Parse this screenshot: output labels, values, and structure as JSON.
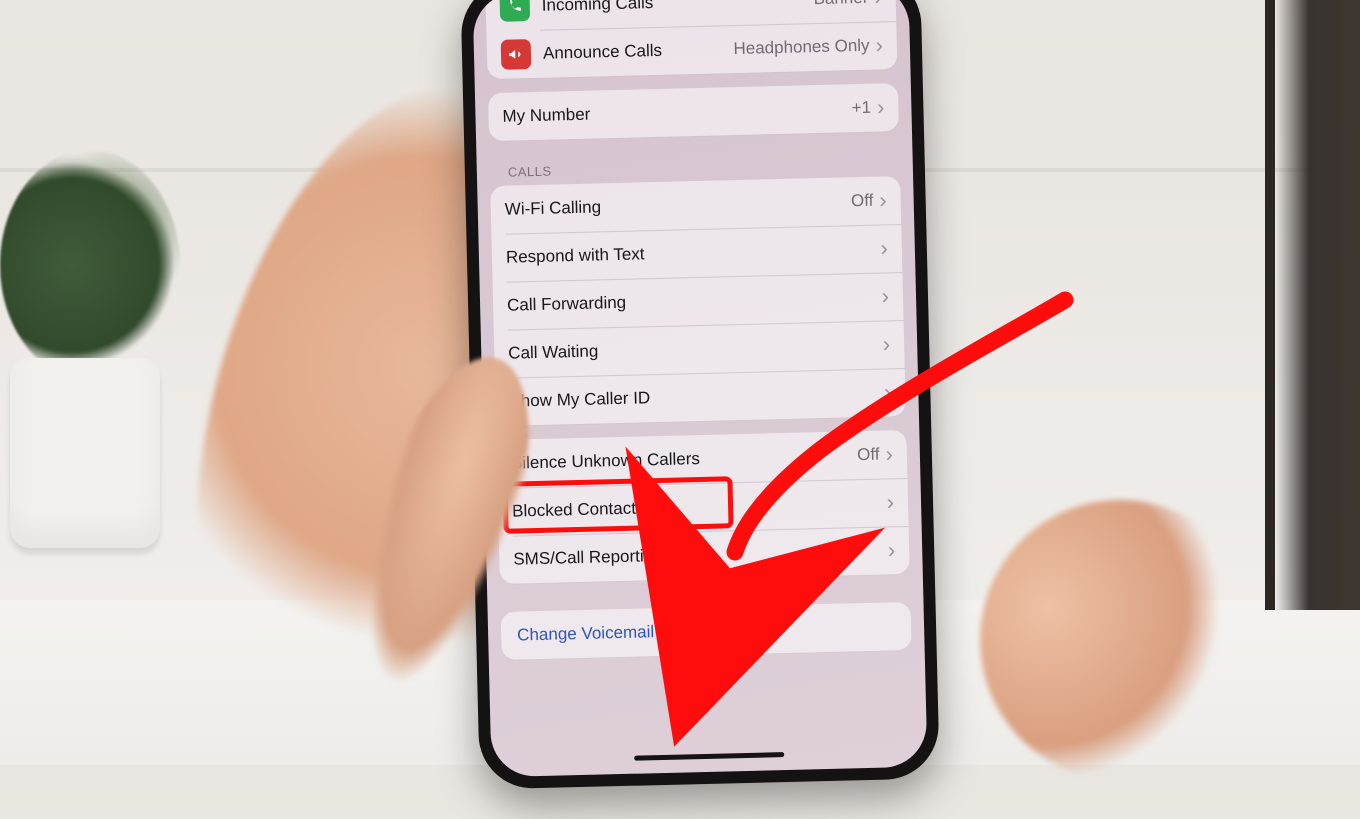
{
  "sections": {
    "top": {
      "incoming_calls_label": "Incoming Calls",
      "incoming_calls_value": "Banner",
      "announce_calls_label": "Announce Calls",
      "announce_calls_value": "Headphones Only"
    },
    "my_number": {
      "label": "My Number",
      "value": "+1"
    },
    "calls_header": "CALLS",
    "calls": {
      "wifi_calling_label": "Wi-Fi Calling",
      "wifi_calling_value": "Off",
      "respond_with_text_label": "Respond with Text",
      "call_forwarding_label": "Call Forwarding",
      "call_waiting_label": "Call Waiting",
      "show_caller_id_label": "Show My Caller ID"
    },
    "silence": {
      "silence_unknown_label": "Silence Unknown Callers",
      "silence_unknown_value": "Off",
      "blocked_contacts_label": "Blocked Contacts",
      "sms_reporting_label": "SMS/Call Reporting"
    },
    "voicemail_link": "Change Voicemail Password"
  },
  "icons": {
    "phone_down": "↴",
    "megaphone": "📢"
  },
  "annotation": {
    "highlight_target": "blocked-contacts-row",
    "highlight_color": "#ff0d0d"
  }
}
